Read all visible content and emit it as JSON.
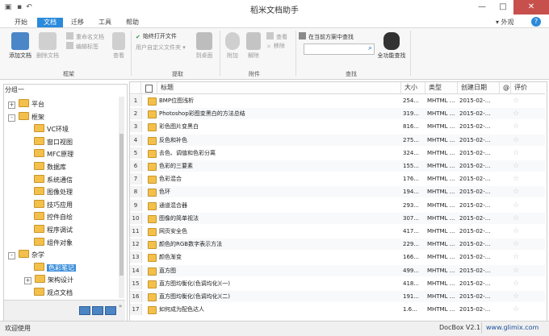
{
  "window": {
    "title": "稻米文档助手",
    "skin_label": "外观",
    "help_glyph": "?"
  },
  "tabs": [
    "开始",
    "文档",
    "迁移",
    "工具",
    "帮助"
  ],
  "ribbon": {
    "add_doc": "添加文档",
    "delete_doc": "删除文档",
    "rename_doc": "重命名文档",
    "edit_tags": "编辑标签",
    "view": "查看",
    "group_frame": "框架",
    "always_open_file": "始终打开文件",
    "user_defined_file": "用户自定义文件夹",
    "to_desktop": "到桌面",
    "group_extract": "提取",
    "attach": "附加",
    "detach": "解除",
    "attach_view": "查看",
    "remove": "移除",
    "group_attachment": "附件",
    "search_in_current": "在当前方案中查找",
    "search_value": "",
    "full_search": "全功能查找",
    "group_search": "查找"
  },
  "tree": {
    "header": "分组一",
    "nodes": [
      {
        "label": "平台",
        "level": 1,
        "exp": "+"
      },
      {
        "label": "框架",
        "level": 1,
        "exp": "-"
      },
      {
        "label": "VC环境",
        "level": 2,
        "exp": ""
      },
      {
        "label": "窗口视图",
        "level": 2,
        "exp": ""
      },
      {
        "label": "MFC原理",
        "level": 2,
        "exp": ""
      },
      {
        "label": "数据库",
        "level": 2,
        "exp": ""
      },
      {
        "label": "系统通信",
        "level": 2,
        "exp": ""
      },
      {
        "label": "图像处理",
        "level": 2,
        "exp": ""
      },
      {
        "label": "技巧应用",
        "level": 2,
        "exp": ""
      },
      {
        "label": "控件自绘",
        "level": 2,
        "exp": ""
      },
      {
        "label": "程序调试",
        "level": 2,
        "exp": ""
      },
      {
        "label": "组件对象",
        "level": 2,
        "exp": ""
      },
      {
        "label": "杂学",
        "level": 1,
        "exp": "-"
      },
      {
        "label": "色彩笔记",
        "level": 2,
        "exp": "",
        "selected": true
      },
      {
        "label": "架构设计",
        "level": 2,
        "exp": "+"
      },
      {
        "label": "观点文档",
        "level": 2,
        "exp": ""
      }
    ]
  },
  "table": {
    "headers": [
      "标题",
      "大小",
      "类型",
      "创建日期",
      "评价"
    ],
    "attach_header": "@",
    "rows": [
      {
        "n": "1",
        "title": "BMP位图浅析",
        "size": "254...",
        "type": "MHTML ...",
        "date": "2015-02-..."
      },
      {
        "n": "2",
        "title": "Photoshop彩图变黑白的方法总结",
        "size": "319...",
        "type": "MHTML ...",
        "date": "2015-02-..."
      },
      {
        "n": "3",
        "title": "彩色图片变黑白",
        "size": "816...",
        "type": "MHTML ...",
        "date": "2015-02-..."
      },
      {
        "n": "4",
        "title": "反色和补色",
        "size": "275...",
        "type": "MHTML ...",
        "date": "2015-02-..."
      },
      {
        "n": "5",
        "title": "去色、调值和色彩分离",
        "size": "324...",
        "type": "MHTML ...",
        "date": "2015-02-..."
      },
      {
        "n": "6",
        "title": "色彩的三要素",
        "size": "155...",
        "type": "MHTML ...",
        "date": "2015-02-..."
      },
      {
        "n": "7",
        "title": "色彩混合",
        "size": "176...",
        "type": "MHTML ...",
        "date": "2015-02-..."
      },
      {
        "n": "8",
        "title": "色环",
        "size": "194...",
        "type": "MHTML ...",
        "date": "2015-02-..."
      },
      {
        "n": "9",
        "title": "通道混合器",
        "size": "293...",
        "type": "MHTML ...",
        "date": "2015-02-..."
      },
      {
        "n": "10",
        "title": "图像的简单视法",
        "size": "307...",
        "type": "MHTML ...",
        "date": "2015-02-..."
      },
      {
        "n": "11",
        "title": "网页安全色",
        "size": "417...",
        "type": "MHTML ...",
        "date": "2015-02-..."
      },
      {
        "n": "12",
        "title": "颜色的RGB数字表示方法",
        "size": "229...",
        "type": "MHTML ...",
        "date": "2015-02-..."
      },
      {
        "n": "13",
        "title": "颜色渐变",
        "size": "166...",
        "type": "MHTML ...",
        "date": "2015-02-..."
      },
      {
        "n": "14",
        "title": "直方图",
        "size": "499...",
        "type": "MHTML ...",
        "date": "2015-02-..."
      },
      {
        "n": "15",
        "title": "直方图均衡化(色调均化)(一)",
        "size": "418...",
        "type": "MHTML ...",
        "date": "2015-02-..."
      },
      {
        "n": "16",
        "title": "直方图均衡化(色调均化)(二)",
        "size": "191...",
        "type": "MHTML ...",
        "date": "2015-02-..."
      },
      {
        "n": "17",
        "title": "如何成为配色达人",
        "size": "1.6...",
        "type": "MHTML ...",
        "date": "2015-02-..."
      }
    ]
  },
  "status": {
    "left": "欢迎使用",
    "version": "DocBox V2.1",
    "url": "www.glimix.com"
  },
  "colors": {
    "accent": "#2a8adb",
    "close": "#c7504d",
    "folder": "#f3c04c"
  }
}
